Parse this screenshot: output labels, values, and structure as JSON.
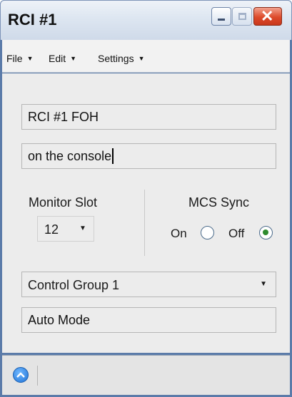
{
  "window": {
    "title": "RCI #1",
    "controls": {
      "minimize_icon": "minimize-icon",
      "maximize_icon": "maximize-icon",
      "close_icon": "close-icon"
    }
  },
  "menubar": {
    "items": [
      {
        "label": "File"
      },
      {
        "label": "Edit"
      },
      {
        "label": "Settings"
      }
    ]
  },
  "form": {
    "name_value": "RCI #1 FOH",
    "location_value": "on the console",
    "monitor_slot": {
      "label": "Monitor Slot",
      "selected": "12"
    },
    "mcs_sync": {
      "label": "MCS Sync",
      "on_label": "On",
      "off_label": "Off",
      "selected": "Off"
    },
    "control_group": {
      "selected": "Control Group 1"
    },
    "mode_value": "Auto Mode"
  },
  "statusbar": {
    "button_icon": "chevron-up-icon"
  },
  "colors": {
    "selected_radio": "#2e8b2e",
    "close_button": "#dd4a2a",
    "frame": "#5b7ba9"
  }
}
